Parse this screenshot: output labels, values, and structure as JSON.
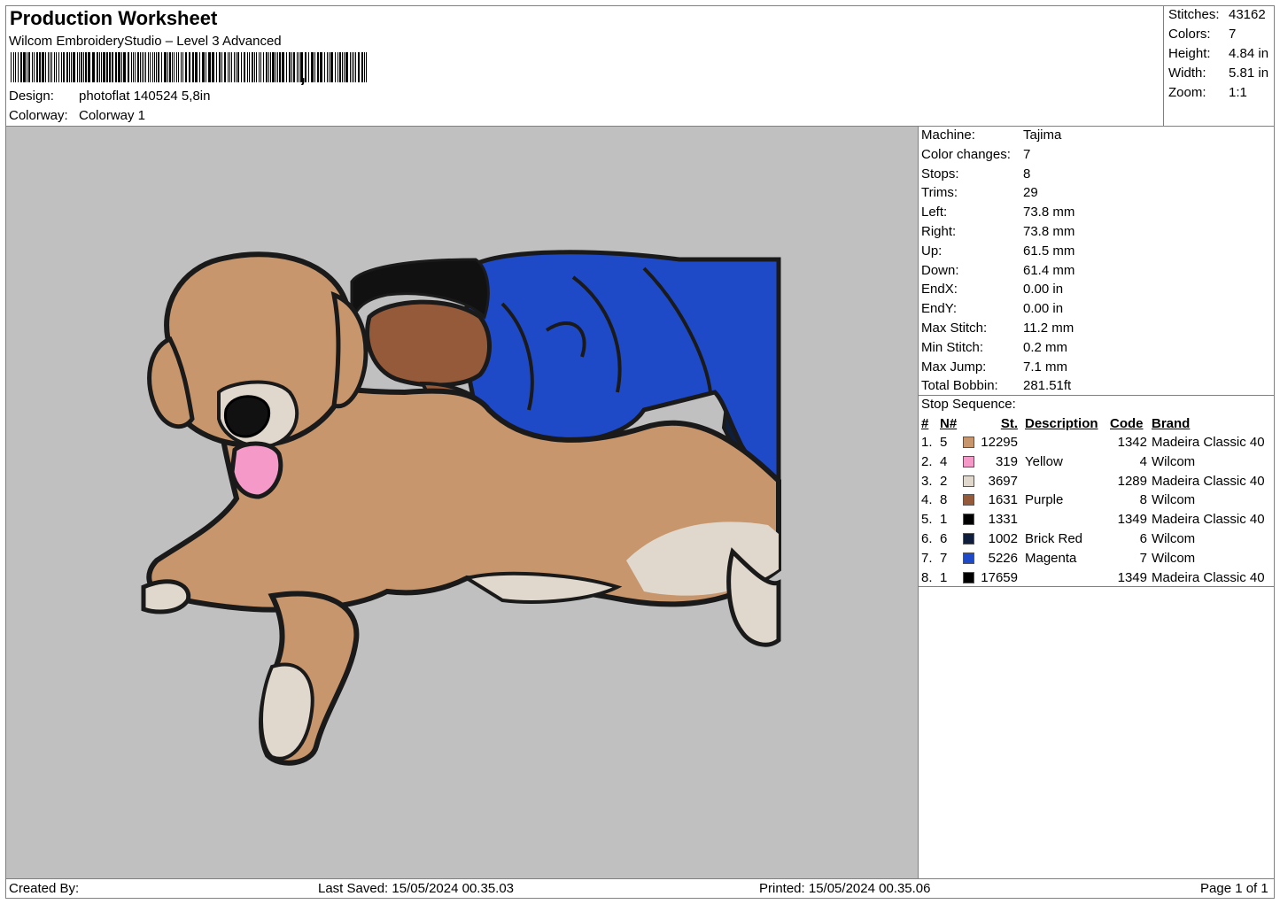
{
  "header": {
    "title": "Production Worksheet",
    "software": "Wilcom EmbroideryStudio – Level 3 Advanced",
    "barcode_suffix": ",",
    "design_label": "Design:",
    "design_value": "photoflat 140524 5,8in",
    "colorway_label": "Colorway:",
    "colorway_value": "Colorway 1"
  },
  "summary": [
    {
      "label": "Stitches:",
      "value": "43162"
    },
    {
      "label": "Colors:",
      "value": "7"
    },
    {
      "label": "Height:",
      "value": "4.84 in"
    },
    {
      "label": "Width:",
      "value": "5.81 in"
    },
    {
      "label": "Zoom:",
      "value": "1:1"
    }
  ],
  "machine_info": [
    {
      "label": "Machine:",
      "value": "Tajima"
    },
    {
      "label": "Color changes:",
      "value": "7"
    },
    {
      "label": "Stops:",
      "value": "8"
    },
    {
      "label": "Trims:",
      "value": "29"
    },
    {
      "label": "Left:",
      "value": "73.8 mm"
    },
    {
      "label": "Right:",
      "value": "73.8 mm"
    },
    {
      "label": "Up:",
      "value": "61.5 mm"
    },
    {
      "label": "Down:",
      "value": "61.4 mm"
    },
    {
      "label": "EndX:",
      "value": "0.00 in"
    },
    {
      "label": "EndY:",
      "value": "0.00 in"
    },
    {
      "label": "Max Stitch:",
      "value": "11.2 mm"
    },
    {
      "label": "Min Stitch:",
      "value": "0.2 mm"
    },
    {
      "label": "Max Jump:",
      "value": "7.1 mm"
    },
    {
      "label": "Total Bobbin:",
      "value": "281.51ft"
    }
  ],
  "stop_sequence": {
    "title": "Stop Sequence:",
    "columns": {
      "num": "#",
      "n": "N#",
      "st": "St.",
      "description": "Description",
      "code": "Code",
      "brand": "Brand"
    },
    "rows": [
      {
        "num": "1.",
        "n": "5",
        "color": "#c8966c",
        "st": "12295",
        "description": "",
        "code": "1342",
        "brand": "Madeira Classic 40"
      },
      {
        "num": "2.",
        "n": "4",
        "color": "#f59ac8",
        "st": "319",
        "description": "Yellow",
        "code": "4",
        "brand": "Wilcom"
      },
      {
        "num": "3.",
        "n": "2",
        "color": "#e0d8cc",
        "st": "3697",
        "description": "",
        "code": "1289",
        "brand": "Madeira Classic 40"
      },
      {
        "num": "4.",
        "n": "8",
        "color": "#955a3a",
        "st": "1631",
        "description": "Purple",
        "code": "8",
        "brand": "Wilcom"
      },
      {
        "num": "5.",
        "n": "1",
        "color": "#000000",
        "st": "1331",
        "description": "",
        "code": "1349",
        "brand": "Madeira Classic 40"
      },
      {
        "num": "6.",
        "n": "6",
        "color": "#0f1e3c",
        "st": "1002",
        "description": "Brick Red",
        "code": "6",
        "brand": "Wilcom"
      },
      {
        "num": "7.",
        "n": "7",
        "color": "#1e4ac8",
        "st": "5226",
        "description": "Magenta",
        "code": "7",
        "brand": "Wilcom"
      },
      {
        "num": "8.",
        "n": "1",
        "color": "#000000",
        "st": "17659",
        "description": "",
        "code": "1349",
        "brand": "Madeira Classic 40"
      }
    ]
  },
  "footer": {
    "created_by": "Created By:",
    "last_saved": "Last Saved: 15/05/2024 00.35.03",
    "printed": "Printed: 15/05/2024 00.35.06",
    "page": "Page 1 of 1"
  },
  "colors": {
    "canvas_bg": "#c0c0c0",
    "dog_fur": "#c8966c",
    "dog_light": "#e0d8cc",
    "tongue": "#f59ac8",
    "skin": "#955a3a",
    "shirt": "#1e4ac8",
    "dark_navy": "#0f1e3c",
    "outline": "#1a1a1a"
  }
}
